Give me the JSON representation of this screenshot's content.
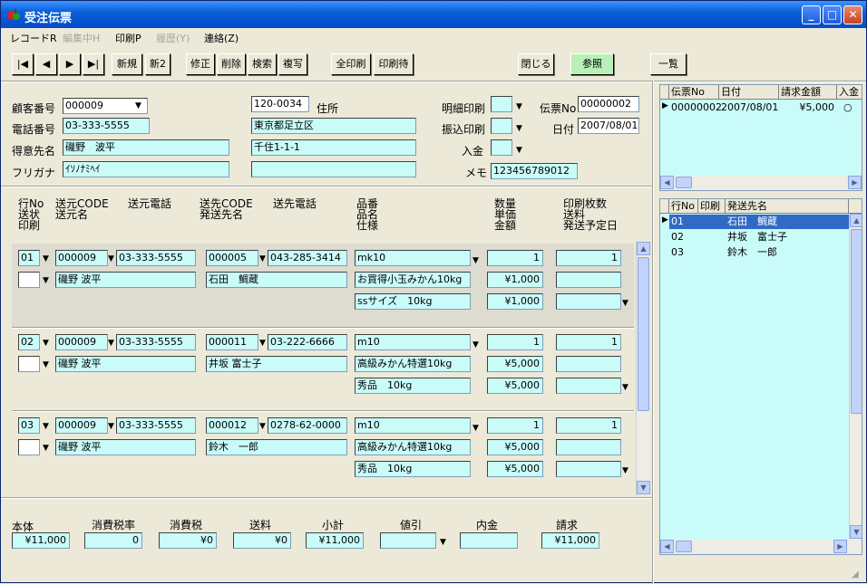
{
  "window": {
    "title": "受注伝票"
  },
  "menu": [
    {
      "label": "レコードR",
      "disabled": false
    },
    {
      "label": "編集中H",
      "disabled": true
    },
    {
      "label": "印刷P",
      "disabled": false
    },
    {
      "label": "履歴(Y)",
      "disabled": true
    },
    {
      "label": "連絡(Z)",
      "disabled": false
    }
  ],
  "toolbar": {
    "first": "|◀",
    "prev": "◀",
    "next": "▶",
    "last": "▶|",
    "new": "新規",
    "new2": "新2",
    "edit": "修正",
    "delete": "削除",
    "search": "検索",
    "copy": "複写",
    "print_all": "全印刷",
    "print_wait": "印刷待",
    "close": "閉じる",
    "ref": "参照",
    "list": "一覧"
  },
  "header": {
    "customer_no_label": "顧客番号",
    "customer_no": "000009",
    "phone_label": "電話番号",
    "phone": "03-333-5555",
    "client_label": "得意先名",
    "client": "磯野　波平",
    "kana_label": "フリガナ",
    "kana": "ｲｿﾉﾅﾐﾍｲ",
    "zip": "120-0034",
    "address_label": "住所",
    "address1": "東京都足立区",
    "address2": "千住1-1-1",
    "address3": "",
    "detail_print_label": "明細印刷",
    "transfer_print_label": "振込印刷",
    "payment_label": "入金",
    "memo_label": "メモ",
    "memo": "123456789012",
    "slip_no_label": "伝票No",
    "slip_no": "00000002",
    "date_label": "日付",
    "date": "2007/08/01"
  },
  "columns": {
    "c1": [
      "行No",
      "送状",
      "印刷"
    ],
    "c2": [
      "送元CODE",
      "送元名"
    ],
    "c3": [
      "送元電話"
    ],
    "c4": [
      "送先CODE",
      "発送先名"
    ],
    "c5": [
      "送先電話"
    ],
    "c6": [
      "品番",
      "品名",
      "仕様"
    ],
    "c7": [
      "数量",
      "単価",
      "金額"
    ],
    "c8": [
      "印刷枚数",
      "送料",
      "発送予定日"
    ]
  },
  "rows": [
    {
      "no": "01",
      "src_code": "000009",
      "src_phone": "03-333-5555",
      "src_name": "磯野 波平",
      "dst_code": "000005",
      "dst_phone": "043-285-3414",
      "dst_name": "石田　鯛蔵",
      "item_code": "mk10",
      "item_name": "お買得小玉みかん10kg",
      "spec": "ssサイズ　10kg",
      "qty": "1",
      "price": "¥1,000",
      "amount": "¥1,000",
      "copies": "1"
    },
    {
      "no": "02",
      "src_code": "000009",
      "src_phone": "03-333-5555",
      "src_name": "磯野 波平",
      "dst_code": "000011",
      "dst_phone": "03-222-6666",
      "dst_name": "井坂 富士子",
      "item_code": "m10",
      "item_name": "高級みかん特選10kg",
      "spec": "秀品　10kg",
      "qty": "1",
      "price": "¥5,000",
      "amount": "¥5,000",
      "copies": "1"
    },
    {
      "no": "03",
      "src_code": "000009",
      "src_phone": "03-333-5555",
      "src_name": "磯野 波平",
      "dst_code": "000012",
      "dst_phone": "0278-62-0000",
      "dst_name": "鈴木　一郎",
      "item_code": "m10",
      "item_name": "高級みかん特選10kg",
      "spec": "秀品　10kg",
      "qty": "1",
      "price": "¥5,000",
      "amount": "¥5,000",
      "copies": "1"
    }
  ],
  "totals": {
    "body_label": "本体",
    "body": "¥11,000",
    "tax_rate_label": "消費税率",
    "tax_rate": "0",
    "tax_label": "消費税",
    "tax": "¥0",
    "shipping_label": "送料",
    "shipping": "¥0",
    "subtotal_label": "小計",
    "subtotal": "¥11,000",
    "discount_label": "値引",
    "discount": "",
    "deposit_label": "内金",
    "deposit": "",
    "invoice_label": "請求",
    "invoice": "¥11,000"
  },
  "slip_list": {
    "headers": [
      "伝票No",
      "日付",
      "請求金額",
      "入金"
    ],
    "rows": [
      {
        "no": "00000002",
        "date": "2007/08/01",
        "amount": "¥5,000",
        "paid": "○"
      }
    ]
  },
  "dest_list": {
    "headers": [
      "行No",
      "印刷",
      "発送先名"
    ],
    "rows": [
      {
        "no": "01",
        "print": "",
        "name": "石田　鯛蔵"
      },
      {
        "no": "02",
        "print": "",
        "name": "井坂　富士子"
      },
      {
        "no": "03",
        "print": "",
        "name": "鈴木　一郎"
      }
    ]
  }
}
